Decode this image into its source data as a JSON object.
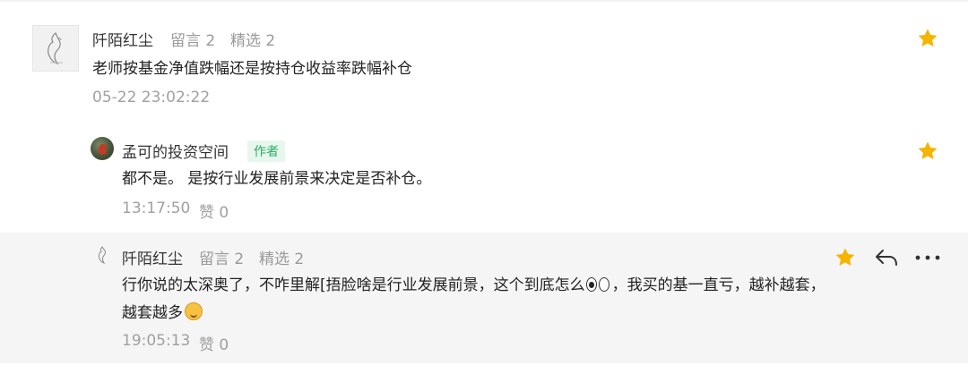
{
  "comments": [
    {
      "user": "阡陌红尘",
      "messages": "留言 2",
      "featured": "精选 2",
      "text": "老师按基金净值跌幅还是按持仓收益率跌幅补仓",
      "time": "05-22 23:02:22"
    },
    {
      "user": "孟可的投资空间",
      "badge": "作者",
      "text": "都不是。  是按行业发展前景来决定是否补仓。",
      "time": "13:17:50",
      "likes": "赞 0"
    },
    {
      "user": "阡陌红尘",
      "messages": "留言 2",
      "featured": "精选 2",
      "text_line1_a": "行你说的太深奥了，不咋里解[捂脸啥是行业发展前景，这个到底怎么",
      "text_line1_b": "，我买的基一直亏，越补越套，",
      "text_line2": "越套越多",
      "time": "19:05:13",
      "likes": "赞 0"
    }
  ],
  "colors": {
    "star": "#f5b400",
    "badge_bg": "#e8f7ee",
    "badge_text": "#27ae60",
    "highlight_bg": "#f5f5f5"
  },
  "icons": {
    "star": "star-icon",
    "reply": "reply-icon",
    "more": "more-icon"
  }
}
